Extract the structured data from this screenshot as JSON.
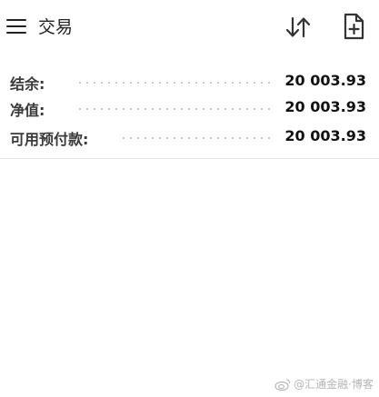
{
  "toolbar": {
    "title": "交易",
    "icons": {
      "menu": "hamburger-menu-icon",
      "sort": "sort-arrows-icon",
      "new_document": "document-add-icon"
    }
  },
  "summary": {
    "rows": [
      {
        "label": "结余:",
        "value": "20 003.93"
      },
      {
        "label": "净值:",
        "value": "20 003.93"
      },
      {
        "label": "可用预付款:",
        "value": "20 003.93"
      }
    ]
  },
  "watermark": {
    "text": "@汇通金融·博客"
  }
}
